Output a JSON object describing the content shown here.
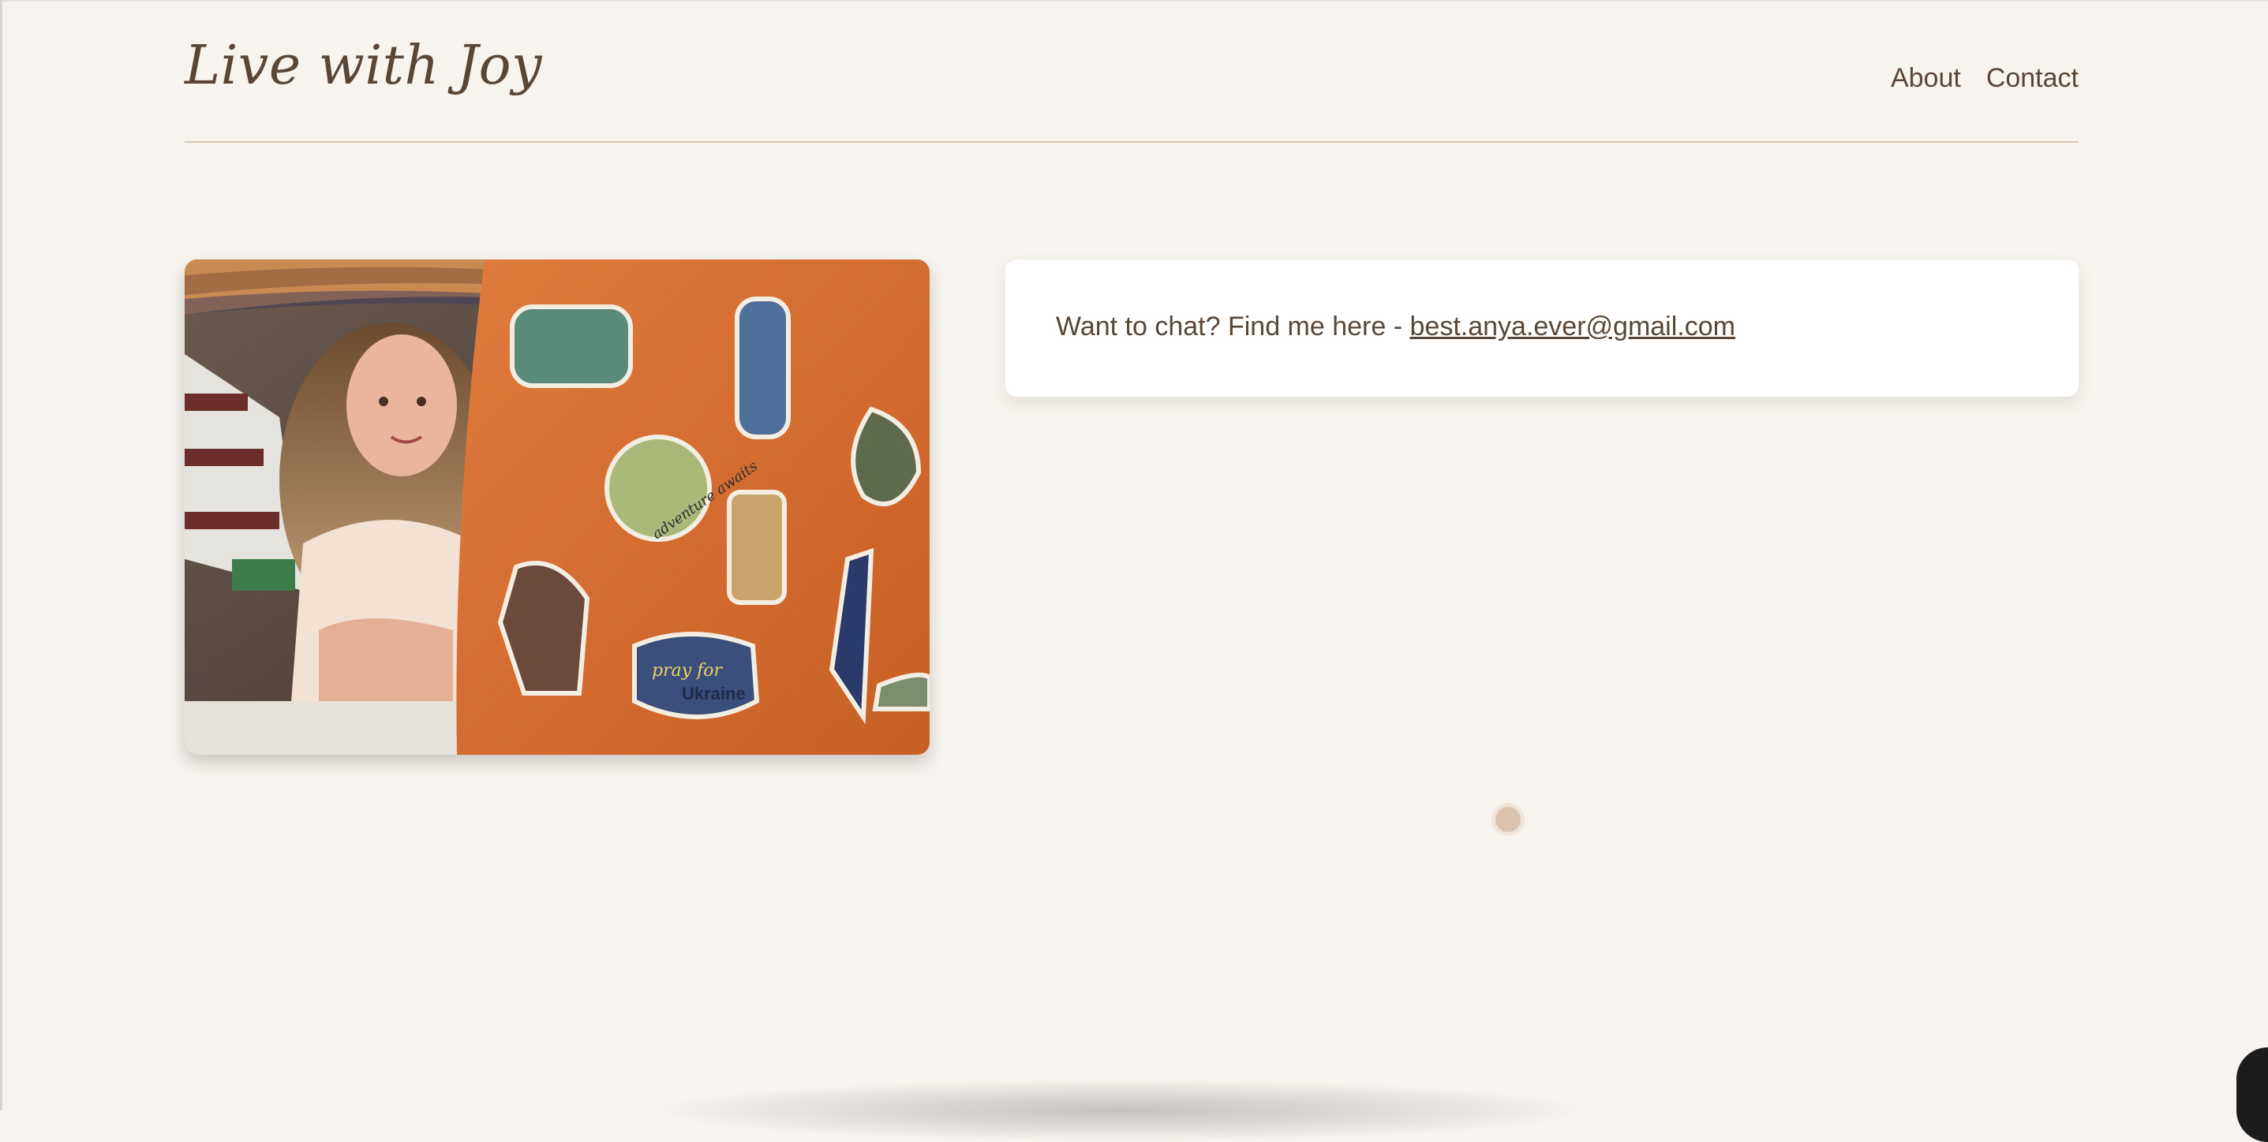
{
  "site": {
    "title": "Live with Joy"
  },
  "nav": {
    "items": [
      {
        "label": "About"
      },
      {
        "label": "Contact"
      }
    ]
  },
  "contact": {
    "prefix": "Want to chat? Find me here - ",
    "email": "best.anya.ever@gmail.com"
  },
  "image": {
    "subject": "woman-smiling-behind-laptop-with-stickers",
    "sticker_texts": [
      "adventure awaits",
      "pray for",
      "Ukraine"
    ]
  },
  "colors": {
    "background": "#f7f3ee",
    "text": "#5a4636",
    "accent_line": "#dcc3ae",
    "card": "#ffffff",
    "laptop": "#d9713a"
  }
}
